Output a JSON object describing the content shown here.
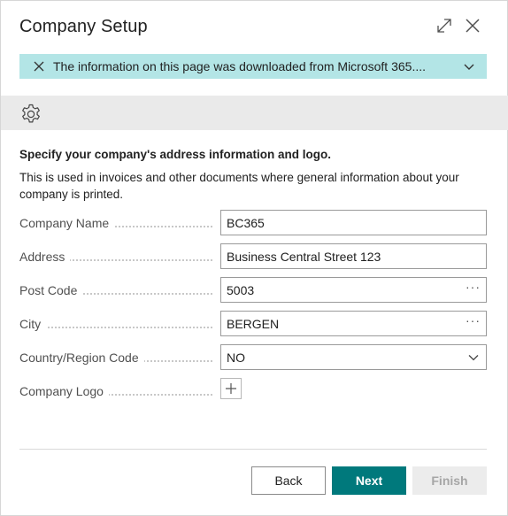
{
  "dialog": {
    "title": "Company Setup"
  },
  "banner": {
    "text": "The information on this page was downloaded from Microsoft 365...."
  },
  "content": {
    "heading": "Specify your company's address information and logo.",
    "description": "This is used in invoices and other documents where general information about your company is printed."
  },
  "fields": {
    "company_name": {
      "label": "Company Name",
      "value": "BC365"
    },
    "address": {
      "label": "Address",
      "value": "Business Central Street 123"
    },
    "post_code": {
      "label": "Post Code",
      "value": "5003",
      "lookup": "···"
    },
    "city": {
      "label": "City",
      "value": "BERGEN",
      "lookup": "···"
    },
    "country": {
      "label": "Country/Region Code",
      "value": "NO"
    },
    "logo": {
      "label": "Company Logo"
    }
  },
  "buttons": {
    "back": "Back",
    "next": "Next",
    "finish": "Finish"
  },
  "colors": {
    "banner_bg": "#b3e5e6",
    "primary": "#00797c",
    "action_bar_bg": "#eaeaea"
  }
}
